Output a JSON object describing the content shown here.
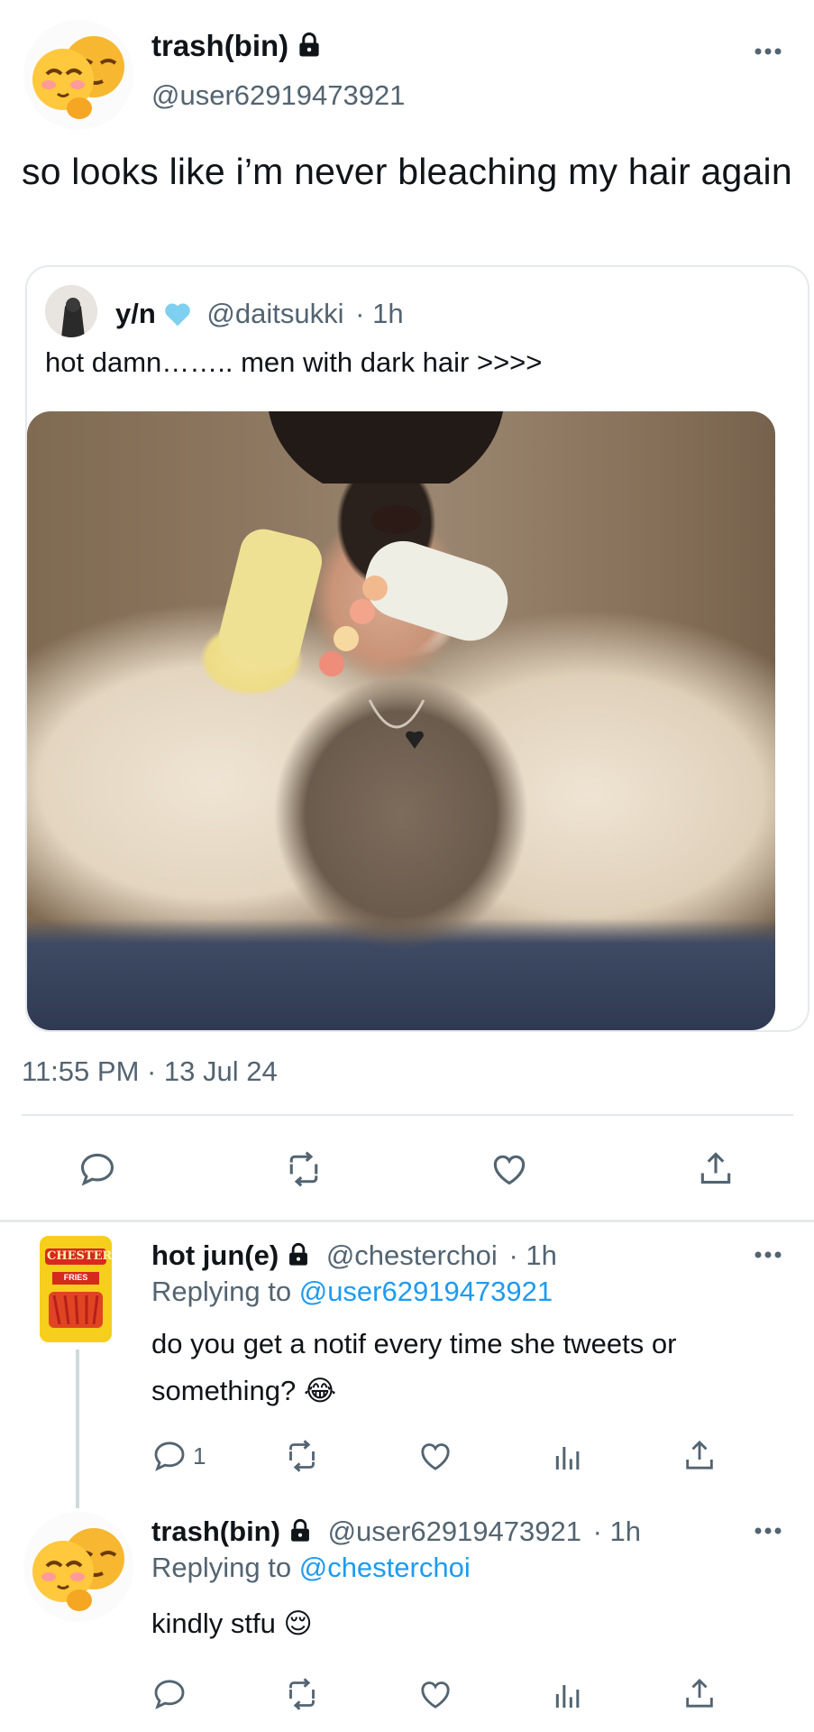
{
  "tweet": {
    "display_name": "trash(bin)",
    "handle": "@user62919473921",
    "text": "so looks like i’m never bleaching my hair again",
    "timestamp": "11:55 PM · 13 Jul 24",
    "avatar_icon": "pleading-relieved-emoji-avatar",
    "more_icon": "ellipsis-icon"
  },
  "quoted": {
    "display_name": "y/n",
    "handle": "@daitsukki",
    "time": "· 1h",
    "text": "hot damn…….. men with dark hair >>>>",
    "verified_color": "#7fd0f0"
  },
  "actions": {
    "reply": "reply-icon",
    "retweet": "retweet-icon",
    "like": "heart-icon",
    "share": "share-icon"
  },
  "replies": [
    {
      "display_name": "hot jun(e)",
      "handle": "@chesterchoi",
      "time": "· 1h",
      "replying_prefix": "Replying to",
      "replying_to": "@user62919473921",
      "text": "do you get a notif every time she tweets or something? 😂",
      "reply_count": "1",
      "avatar_brand": "CHESTER'S",
      "avatar_sub": "FRIES"
    },
    {
      "display_name": "trash(bin)",
      "handle": "@user62919473921",
      "time": "· 1h",
      "replying_prefix": "Replying to",
      "replying_to": "@chesterchoi",
      "text": "kindly stfu 😌",
      "reply_count": ""
    }
  ],
  "colors": {
    "accent": "#1d9bf0",
    "muted": "#536471",
    "divider": "#e6e9ec"
  }
}
